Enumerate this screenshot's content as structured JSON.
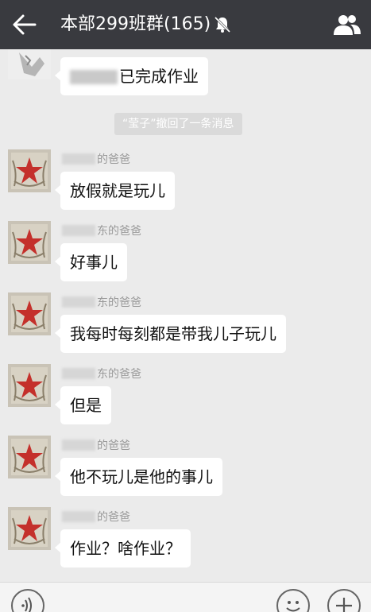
{
  "header": {
    "title": "本部299班群(165)",
    "back_icon": "arrow-left-icon",
    "mute_icon": "bell-off-icon",
    "members_icon": "group-members-icon"
  },
  "messages": [
    {
      "sender": "",
      "text_suffix": "已完成作业"
    },
    {
      "system": "“莹子”撤回了一条消息"
    },
    {
      "sender_suffix": "的爸爸",
      "text": "放假就是玩儿"
    },
    {
      "sender_suffix": "东的爸爸",
      "text": "好事儿"
    },
    {
      "sender_suffix": "东的爸爸",
      "text": "我每时每刻都是带我儿子玩儿"
    },
    {
      "sender_suffix": "东的爸爸",
      "text": "但是"
    },
    {
      "sender_suffix": "的爸爸",
      "text": "他不玩儿是他的事儿"
    },
    {
      "sender_suffix": "的爸爸",
      "text": "作业？啥作业？"
    }
  ],
  "input_bar": {
    "voice_icon": "voice-icon",
    "emoji_icon": "emoji-icon",
    "plus_icon": "plus-icon"
  }
}
